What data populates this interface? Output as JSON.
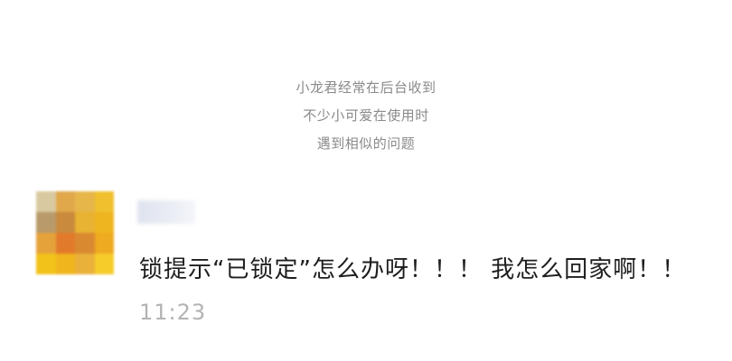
{
  "intro": {
    "lines": [
      "小龙君经常在后台收到",
      "不少小可爱在使用时",
      "遇到相似的问题"
    ]
  },
  "comment": {
    "text": "锁提示“已锁定”怎么办呀！！！ 我怎么回家啊！！",
    "time": "11:23"
  }
}
